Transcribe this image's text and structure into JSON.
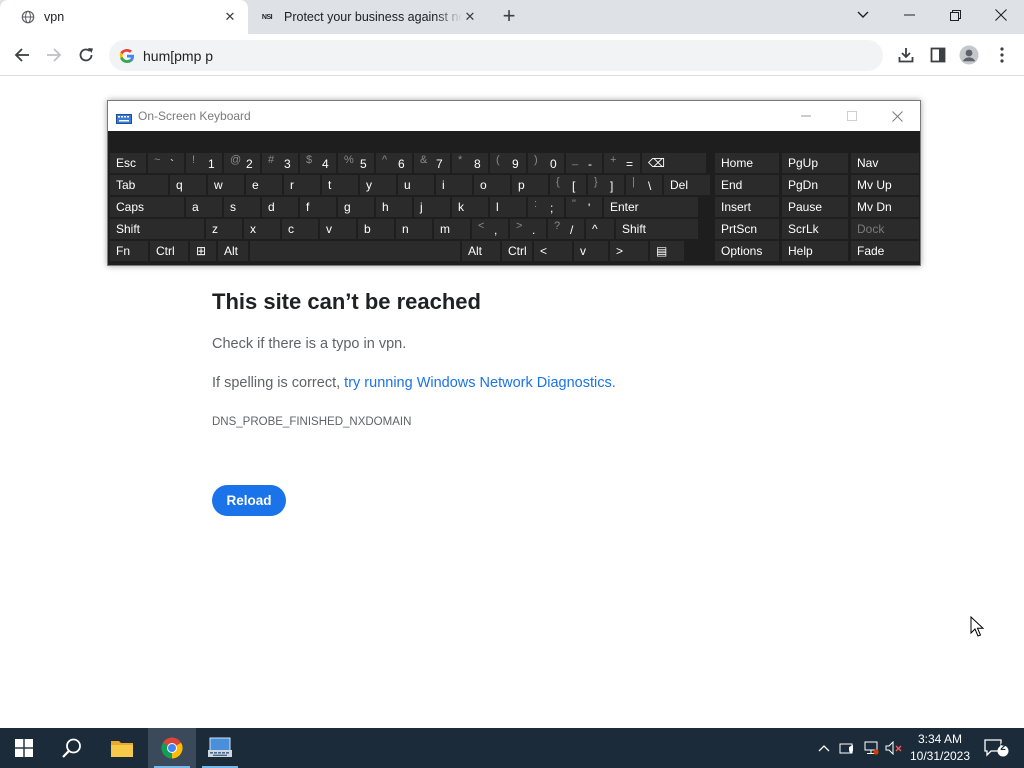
{
  "browser": {
    "tabs": [
      {
        "title": "vpn",
        "favicon": "globe-icon",
        "active": true
      },
      {
        "title": "Protect your business against ne",
        "favicon": "NSI",
        "active": false
      }
    ],
    "address_bar": {
      "value": "hum[pmp p"
    },
    "controls": {
      "new_tab": "+"
    }
  },
  "error_page": {
    "title": "This site can’t be reached",
    "check_text": "Check if there is a typo in vpn.",
    "spelling_prefix": "If spelling is correct, ",
    "diagnostics_link": "try running Windows Network Diagnostics",
    "diagnostics_suffix": ".",
    "error_code": "DNS_PROBE_FINISHED_NXDOMAIN",
    "reload_label": "Reload"
  },
  "osk": {
    "title": "On-Screen Keyboard",
    "rows": [
      [
        {
          "main": "Esc"
        },
        {
          "sub": "~",
          "main": "`"
        },
        {
          "sub": "!",
          "main": "1"
        },
        {
          "sub": "@",
          "main": "2"
        },
        {
          "sub": "#",
          "main": "3"
        },
        {
          "sub": "$",
          "main": "4"
        },
        {
          "sub": "%",
          "main": "5"
        },
        {
          "sub": "^",
          "main": "6"
        },
        {
          "sub": "&",
          "main": "7"
        },
        {
          "sub": "*",
          "main": "8"
        },
        {
          "sub": "(",
          "main": "9"
        },
        {
          "sub": ")",
          "main": "0"
        },
        {
          "sub": "_",
          "main": "-"
        },
        {
          "sub": "+",
          "main": "="
        },
        {
          "main": "⌫"
        }
      ],
      [
        {
          "main": "Tab"
        },
        {
          "main": "q"
        },
        {
          "main": "w"
        },
        {
          "main": "e"
        },
        {
          "main": "r"
        },
        {
          "main": "t"
        },
        {
          "main": "y"
        },
        {
          "main": "u"
        },
        {
          "main": "i"
        },
        {
          "main": "o"
        },
        {
          "main": "p"
        },
        {
          "sub": "{",
          "main": "["
        },
        {
          "sub": "}",
          "main": "]"
        },
        {
          "sub": "|",
          "main": "\\"
        },
        {
          "main": "Del"
        }
      ],
      [
        {
          "main": "Caps"
        },
        {
          "main": "a"
        },
        {
          "main": "s"
        },
        {
          "main": "d"
        },
        {
          "main": "f"
        },
        {
          "main": "g"
        },
        {
          "main": "h"
        },
        {
          "main": "j"
        },
        {
          "main": "k"
        },
        {
          "main": "l"
        },
        {
          "sub": ":",
          "main": ";"
        },
        {
          "sub": "\"",
          "main": "'"
        },
        {
          "main": "Enter"
        }
      ],
      [
        {
          "main": "Shift"
        },
        {
          "main": "z"
        },
        {
          "main": "x"
        },
        {
          "main": "c"
        },
        {
          "main": "v"
        },
        {
          "main": "b"
        },
        {
          "main": "n"
        },
        {
          "main": "m"
        },
        {
          "sub": "<",
          "main": ","
        },
        {
          "sub": ">",
          "main": "."
        },
        {
          "sub": "?",
          "main": "/"
        },
        {
          "main": "^"
        },
        {
          "main": "Shift"
        }
      ],
      [
        {
          "main": "Fn"
        },
        {
          "main": "Ctrl"
        },
        {
          "main": "⊞"
        },
        {
          "main": "Alt"
        },
        {
          "main": ""
        },
        {
          "main": "Alt"
        },
        {
          "main": "Ctrl"
        },
        {
          "main": "<"
        },
        {
          "main": "v"
        },
        {
          "main": ">"
        },
        {
          "main": "▤"
        }
      ]
    ],
    "nav_rows": [
      [
        "Home",
        "PgUp",
        "Nav"
      ],
      [
        "End",
        "PgDn",
        "Mv Up"
      ],
      [
        "Insert",
        "Pause",
        "Mv Dn"
      ],
      [
        "PrtScn",
        "ScrLk",
        "Dock"
      ],
      [
        "Options",
        "Help",
        "Fade"
      ]
    ]
  },
  "taskbar": {
    "apps": [
      "start-icon",
      "search-icon",
      "file-explorer-icon",
      "chrome-icon",
      "on-screen-keyboard-icon"
    ],
    "clock_time": "3:34 AM",
    "clock_date": "10/31/2023",
    "notification_count": "2"
  },
  "colors": {
    "accent": "#1a73e8",
    "taskbar": "#1c2b3a",
    "osk_bg": "#1e1e1e",
    "osk_key": "#2b2b2b"
  }
}
